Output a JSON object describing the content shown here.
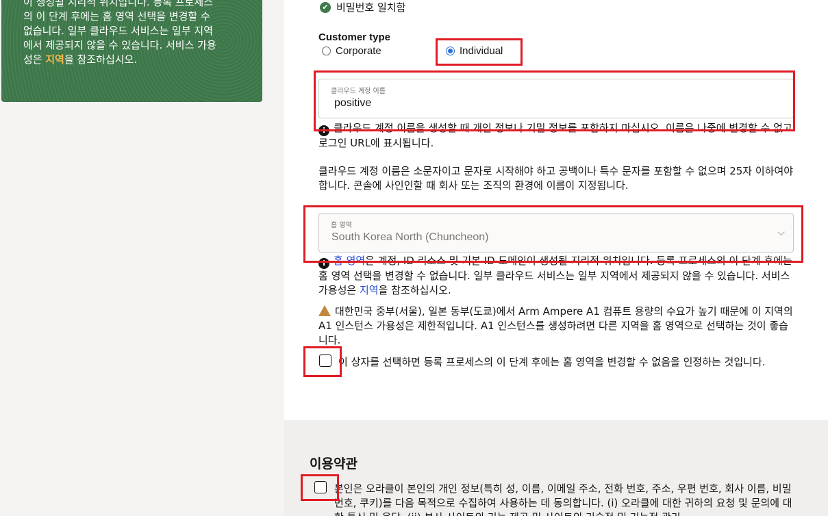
{
  "left_card": {
    "line1": "이 생성될 지리적 위치입니다. 등록 프로세스",
    "line2": "의 이 단계 후에는 홈 영역 선택을 변경할 수",
    "line3": "없습니다. 일부 클라우드 서비스는 일부 지역",
    "line4": "에서 제공되지 않을 수 있습니다. 서비스 가용",
    "line5_prefix": "성은 ",
    "line5_link": "지역",
    "line5_suffix": "을 참조하십시오."
  },
  "password_match": "비밀번호 일치함",
  "customer_type": {
    "label": "Customer type",
    "options": [
      "Corporate",
      "Individual"
    ],
    "selected": "Individual"
  },
  "account_name": {
    "label": "클라우드 계정 이름",
    "value": "positive",
    "help1": "클라우드 계정 이름을 생성할 때 개인 정보나 기밀 정보를 포함하지 마십시오. 이름은 나중에 변경할 수 없고 로그인 URL에 표시됩니다.",
    "help2": "클라우드 계정 이름은 소문자이고 문자로 시작해야 하고 공백이나 특수 문자를 포함할 수 없으며 25자 이하여야 합니다. 콘솔에 사인인할 때 회사 또는 조직의 환경에 이름이 지정됩니다."
  },
  "home_region": {
    "label": "홈 영역",
    "value": "South Korea North (Chuncheon)",
    "help_link": "홈 영역",
    "help_text": "은 계정, ID 리소스 및 기본 ID 도메인이 생성될 지리적 위치입니다. 등록 프로세스의 이 단계 후에는 홈 영역 선택을 변경할 수 없습니다. 일부 클라우드 서비스는 일부 지역에서 제공되지 않을 수 있습니다. 서비스 가용성은 ",
    "help_link2": "지역",
    "help_suffix": "을 참조하십시오.",
    "warning": "대한민국 중부(서울), 일본 동부(도쿄)에서 Arm Ampere A1 컴퓨트 용량의 수요가 높기 때문에 이 지역의 A1 인스턴스 가용성은 제한적입니다. A1 인스턴스를 생성하려면 다른 지역을 홈 영역으로 선택하는 것이 좋습니다.",
    "acknowledge": "이 상자를 선택하면 등록 프로세스의 이 단계 후에는 홈 영역을 변경할 수 없음을 인정하는 것입니다."
  },
  "terms": {
    "title": "이용약관",
    "consent": "본인은 오라클이 본인의 개인 정보(특히 성, 이름, 이메일 주소, 전화 번호, 주소, 우편 번호, 회사 이름, 비밀번호, 쿠키)를 다음 목적으로 수집하여 사용하는 데 동의합니다. (i) 오라클에 대한 귀하의 요청 및 문의에 대한 통신 및 응답, (ii) 본사 사이트의 기능 제공 및 사이트의 기술적 및 기능적 관리"
  }
}
